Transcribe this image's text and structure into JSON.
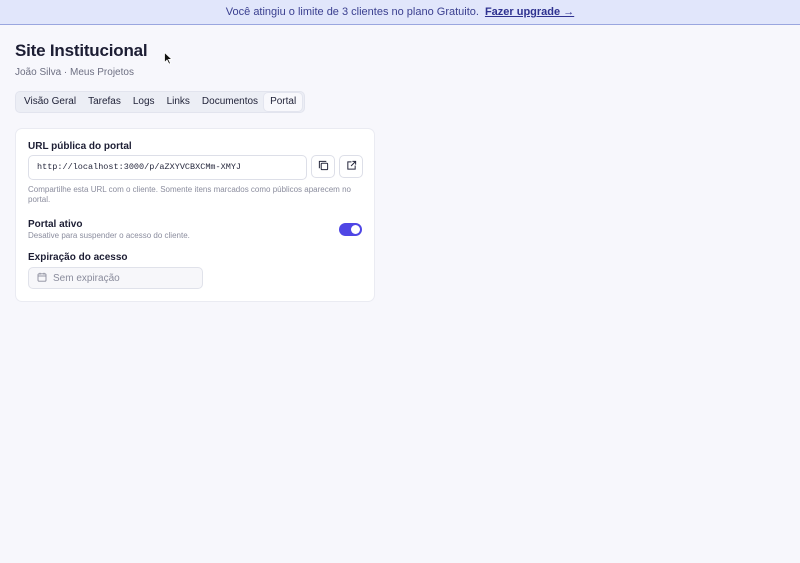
{
  "banner": {
    "message": "Você atingiu o limite de 3 clientes no plano Gratuito.",
    "upgrade_link": "Fazer upgrade →"
  },
  "project": {
    "title": "Site Institucional",
    "breadcrumb": "João Silva · Meus Projetos"
  },
  "tabs": [
    {
      "label": "Visão Geral"
    },
    {
      "label": "Tarefas"
    },
    {
      "label": "Logs"
    },
    {
      "label": "Links"
    },
    {
      "label": "Documentos"
    },
    {
      "label": "Portal",
      "active": true
    }
  ],
  "portal": {
    "url_label": "URL pública do portal",
    "url_value": "http://localhost:3000/p/aZXYVCBXCMm-XMYJ",
    "copy_icon": "copy-icon",
    "open_icon": "external-link-icon",
    "url_hint": "Compartilhe esta URL com o cliente. Somente itens marcados como públicos aparecem no portal.",
    "active_label": "Portal ativo",
    "active_hint": "Desative para suspender o acesso do cliente.",
    "active": true,
    "expiration_label": "Expiração do acesso",
    "expiration_placeholder": "Sem expiração",
    "calendar_icon": "calendar-icon"
  },
  "colors": {
    "accent": "#4f46e5",
    "banner_bg": "#e1e6fb",
    "background": "#f7f7fc"
  }
}
